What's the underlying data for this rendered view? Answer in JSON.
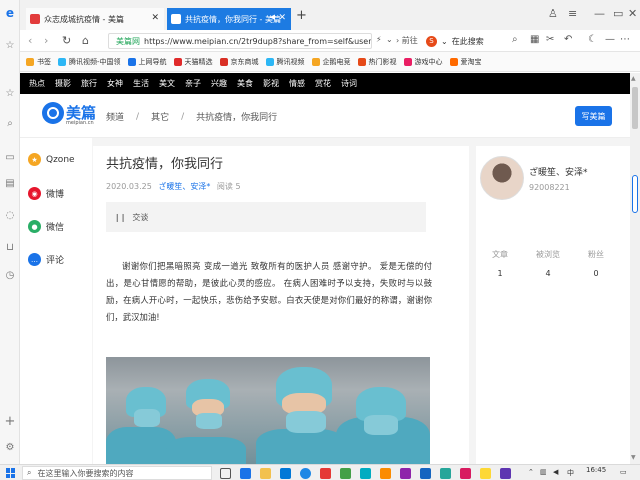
{
  "browser": {
    "tabs": [
      {
        "label": "众志成城抗疫情 - 美篇",
        "active": false
      },
      {
        "label": "共抗疫情，你我同行 - 美篇",
        "active": true
      }
    ],
    "address": {
      "verified_label": "美篇网",
      "url": "https://www.meipian.cn/2tr9dup8?share_from=self&user_id=",
      "goto_label": "前往"
    },
    "search": {
      "label": "在此搜索"
    },
    "bookmarks": [
      {
        "label": "书签",
        "color": "#f5a623"
      },
      {
        "label": "腾讯视频-中国领",
        "color": "#2db7f5"
      },
      {
        "label": "上网导航",
        "color": "#1a73e8"
      },
      {
        "label": "天猫精选",
        "color": "#e02b2b"
      },
      {
        "label": "京东商城",
        "color": "#d93025"
      },
      {
        "label": "腾讯视频",
        "color": "#2db7f5"
      },
      {
        "label": "企鹅电竞",
        "color": "#f5a623"
      },
      {
        "label": "热门影视",
        "color": "#e64a19"
      },
      {
        "label": "游戏中心",
        "color": "#e91e63"
      },
      {
        "label": "爱淘宝",
        "color": "#ff6a00"
      }
    ]
  },
  "site_nav": [
    "热点",
    "摄影",
    "旅行",
    "女神",
    "生活",
    "美文",
    "亲子",
    "兴趣",
    "美食",
    "影视",
    "情感",
    "赏花",
    "诗词"
  ],
  "header": {
    "logo_text": "美篇",
    "logo_sub": "meipian.cn",
    "breadcrumbs": [
      "频道",
      "其它",
      "共抗疫情，你我同行"
    ],
    "write_button": "写美篇"
  },
  "share": [
    {
      "label": "Qzone",
      "icon": "qzone-icon",
      "color": "#f5a623"
    },
    {
      "label": "微博",
      "icon": "weibo-icon",
      "color": "#e6162d"
    },
    {
      "label": "微信",
      "icon": "wechat-icon",
      "color": "#2aae67"
    },
    {
      "label": "评论",
      "icon": "comment-icon",
      "color": "#1a73e8"
    }
  ],
  "article": {
    "title": "共抗疫情，你我同行",
    "date": "2020.03.25",
    "author": "ざ暖笙、安泽*",
    "reads": "阅读 5",
    "music": "交谈",
    "body": "谢谢你们把黑暗照亮 变成一道光 致敬所有的医护人员 感谢守护。 爱是无偿的付出，是心甘情愿的帮助，是彼此心灵的感应。 在病人困难时予以支持，失败时与以鼓励，在病人开心时，一起快乐，悲伤给予安慰。白衣天使是对你们最好的称谓，谢谢你们，武汉加油!"
  },
  "profile": {
    "name": "ざ暖笙、安泽*",
    "id": "92008221",
    "stats": [
      {
        "label": "文章",
        "value": "1"
      },
      {
        "label": "被浏览",
        "value": "4"
      },
      {
        "label": "粉丝",
        "value": "0"
      }
    ]
  },
  "taskbar": {
    "search_placeholder": "在这里输入你要搜索的内容",
    "time": "16:45",
    "ime": "中"
  }
}
